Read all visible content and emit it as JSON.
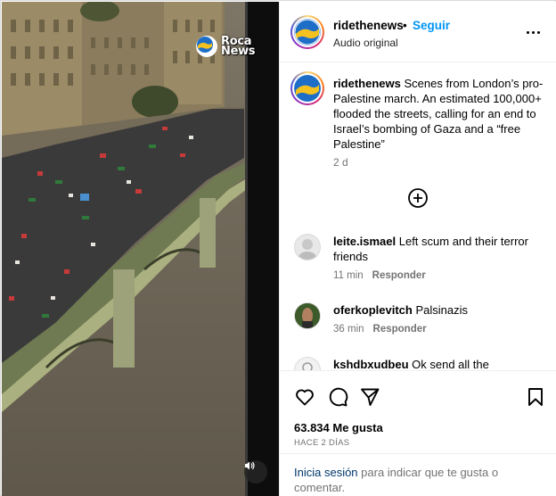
{
  "post": {
    "username": "ridethenews",
    "follow_label": "Seguir",
    "subtitle": "Audio original",
    "caption": "Scenes from London’s pro-Palestine march. An estimated 100,000+ flooded the streets, calling for an end to Israel’s bombing of Gaza and a “free Palestine”",
    "caption_time": "2 d",
    "likes": "63.834 Me gusta",
    "posted_ago": "HACE 2 DÍAS"
  },
  "media": {
    "watermark_line1": "Roca",
    "watermark_line2": "News"
  },
  "comments": [
    {
      "username": "leite.ismael",
      "text": "Left scum and their terror friends",
      "time": "11 min",
      "reply_label": "Responder"
    },
    {
      "username": "oferkoplevitch",
      "text": "Palsinazis",
      "time": "36 min",
      "reply_label": "Responder"
    },
    {
      "username": "kshdbxudbeu",
      "text": "Ok send all the palestine",
      "time": "",
      "reply_label": ""
    }
  ],
  "login": {
    "link_label": "Inicia sesión",
    "rest": " para indicar que te gusta o comentar."
  },
  "icons": {
    "more": "more-options-icon",
    "load_more": "plus-circle-icon",
    "like": "heart-icon",
    "comment": "comment-icon",
    "share": "send-icon",
    "save": "bookmark-icon",
    "audio": "speaker-icon"
  },
  "colors": {
    "link_blue": "#0095f6",
    "login_link": "#00376b",
    "muted": "#737373"
  }
}
